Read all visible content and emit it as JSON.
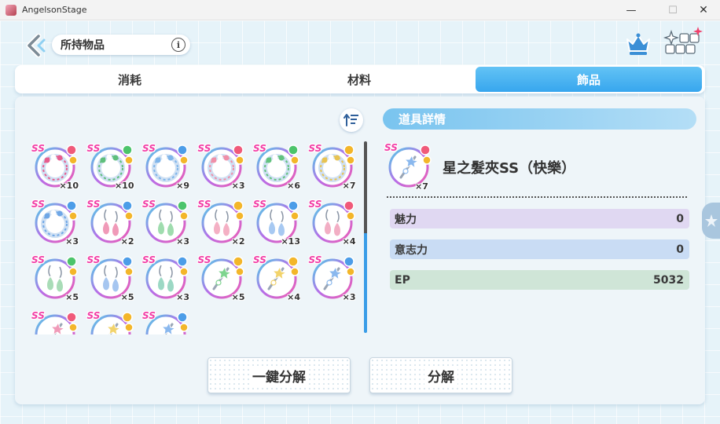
{
  "window": {
    "title": "AngelsonStage",
    "minimize": "—",
    "maximize": "☐",
    "close": "✕"
  },
  "header": {
    "title": "所持物品",
    "info": "i"
  },
  "tabs": [
    {
      "label": "消耗",
      "active": false
    },
    {
      "label": "材料",
      "active": false
    },
    {
      "label": "飾品",
      "active": true
    }
  ],
  "items": [
    {
      "kind": "ring",
      "gem": "#e75d8f",
      "attr": "red",
      "qty": "×10"
    },
    {
      "kind": "ring",
      "gem": "#5fbf7c",
      "attr": "green",
      "qty": "×10"
    },
    {
      "kind": "ring",
      "gem": "#7fb5ea",
      "attr": "blue",
      "qty": "×9"
    },
    {
      "kind": "ring",
      "gem": "#f08fa8",
      "attr": "red",
      "qty": "×3"
    },
    {
      "kind": "ring",
      "gem": "#63c27f",
      "attr": "green",
      "qty": "×6"
    },
    {
      "kind": "ring",
      "gem": "#e8c352",
      "attr": "yellow",
      "qty": "×7"
    },
    {
      "kind": "ring",
      "gem": "#6fa7e6",
      "attr": "blue",
      "qty": "×3"
    },
    {
      "kind": "earring",
      "gem": "#f09ab8",
      "attr": "blue",
      "qty": "×2"
    },
    {
      "kind": "earring",
      "gem": "#9fdcae",
      "attr": "green",
      "qty": "×3"
    },
    {
      "kind": "earring",
      "gem": "#f4b0c4",
      "attr": "yellow",
      "qty": "×2"
    },
    {
      "kind": "earring",
      "gem": "#a7c9f2",
      "attr": "blue",
      "qty": "×13"
    },
    {
      "kind": "earring",
      "gem": "#f2aec4",
      "attr": "red",
      "qty": "×4"
    },
    {
      "kind": "earring",
      "gem": "#a9dcb7",
      "attr": "green",
      "qty": "×5"
    },
    {
      "kind": "earring",
      "gem": "#a6c6f0",
      "attr": "blue",
      "qty": "×5"
    },
    {
      "kind": "earring",
      "gem": "#9cd8c4",
      "attr": "blue",
      "qty": "×3"
    },
    {
      "kind": "clip",
      "gem": "#7ed48f",
      "attr": "yellow",
      "qty": "×5"
    },
    {
      "kind": "clip",
      "gem": "#f2d36b",
      "attr": "yellow",
      "qty": "×4"
    },
    {
      "kind": "clip",
      "gem": "#8ab8ee",
      "attr": "blue",
      "qty": "×3"
    },
    {
      "kind": "clip",
      "gem": "#f09ab8",
      "attr": "red",
      "qty": ""
    },
    {
      "kind": "clip",
      "gem": "#f2d36b",
      "attr": "yellow",
      "qty": ""
    },
    {
      "kind": "clip",
      "gem": "#8ab8ee",
      "attr": "blue",
      "qty": ""
    }
  ],
  "detail": {
    "header": "道具詳情",
    "name": "星之髮夾SS（快樂）",
    "qty": "×7",
    "stats": [
      {
        "label": "魅力",
        "value": "0"
      },
      {
        "label": "意志力",
        "value": "0"
      },
      {
        "label": "EP",
        "value": "5032"
      }
    ]
  },
  "actions": {
    "bulk_disassemble": "一鍵分解",
    "disassemble": "分解"
  },
  "rarity_badge": "SS",
  "colors": {
    "accent": "#37a6ee",
    "rarity": "#f23fa6",
    "attr_red": "#f05a7a",
    "attr_green": "#4cc46b",
    "attr_blue": "#4c9de8",
    "attr_yellow": "#f3b62a"
  }
}
